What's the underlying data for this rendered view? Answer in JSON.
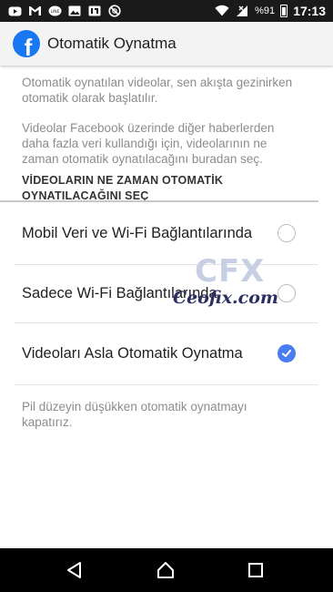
{
  "status_bar": {
    "left_icons": [
      "youtube-icon",
      "gmail-icon",
      "line-icon",
      "gallery-icon",
      "ulaw-icon",
      "disabled-icon"
    ],
    "battery_percent": "%91",
    "time": "17:13"
  },
  "app_bar": {
    "title": "Otomatik Oynatma"
  },
  "content": {
    "description_1": "Otomatik oynatılan videolar, sen akışta gezinirken otomatik olarak başlatılır.",
    "description_2": "Videolar Facebook üzerinde diğer haberlerden daha fazla veri kullandığı için, videolarının ne zaman otomatik oynatılacağını buradan seç.",
    "section_header": "VİDEOLARIN NE ZAMAN OTOMATİK OYNATILACAĞINI SEÇ",
    "options": [
      {
        "label": "Mobil Veri ve Wi-Fi Bağlantılarında",
        "selected": false
      },
      {
        "label": "Sadece Wi-Fi Bağlantılarında",
        "selected": false
      },
      {
        "label": "Videoları Asla Otomatik Oynatma",
        "selected": true
      }
    ],
    "footer_note": "Pil düzeyin düşükken otomatik oynatmayı kapatırız."
  },
  "watermark": {
    "big_text": "CFX",
    "site_text": "Ceofix.com"
  },
  "colors": {
    "accent": "#4a7ef0",
    "facebook_blue": "#1877f2",
    "status_bar": "#1a1a1a",
    "nav_bar": "#000000"
  }
}
